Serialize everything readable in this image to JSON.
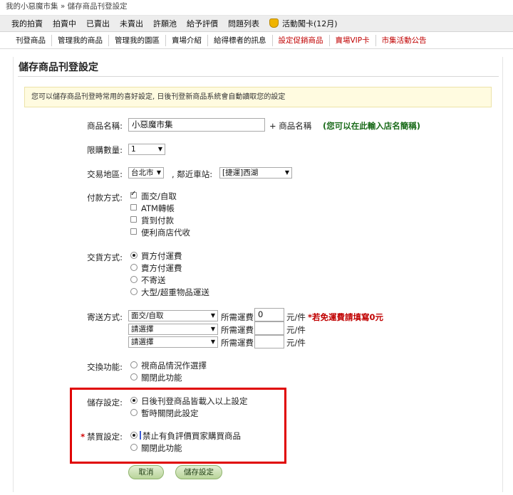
{
  "breadcrumb": {
    "home": "我的小惡魔市集",
    "separator": "»",
    "current": "儲存商品刊登設定"
  },
  "nav_primary": [
    {
      "label": "我的拍賣"
    },
    {
      "label": "拍賣中"
    },
    {
      "label": "已賣出"
    },
    {
      "label": "未賣出"
    },
    {
      "label": "許願池"
    },
    {
      "label": "給予評價"
    },
    {
      "label": "問題列表"
    },
    {
      "label": "活動闖卡(12月)"
    }
  ],
  "nav_secondary": [
    {
      "label": "刊登商品",
      "color": "#111111"
    },
    {
      "label": "管理我的商品",
      "color": "#111111"
    },
    {
      "label": "管理我的園區",
      "color": "#111111"
    },
    {
      "label": "賣場介紹",
      "color": "#111111"
    },
    {
      "label": "給得標者的訊息",
      "color": "#111111"
    },
    {
      "label": "設定促銷商品",
      "color": "#c00000"
    },
    {
      "label": "賣場VIP卡",
      "color": "#c00000"
    },
    {
      "label": "市集活動公告",
      "color": "#c00000"
    }
  ],
  "page_title": "儲存商品刊登設定",
  "notice": "您可以儲存商品刊登時常用的喜好設定, 日後刊登新商品系統會自動讀取您的設定",
  "form": {
    "product_name": {
      "label": "商品名稱:",
      "value": "小惡魔市集",
      "suffix": "+ 商品名稱",
      "note": "(您可以在此輸入店名簡稱)"
    },
    "purchase_limit": {
      "label": "限購數量:",
      "value": "1"
    },
    "trade_area": {
      "label": "交易地區:",
      "city": "台北市",
      "station_label": ", 鄰近車站:",
      "station": "[捷運]西湖"
    },
    "payment": {
      "label": "付款方式:",
      "options": [
        {
          "text": "面交/自取",
          "checked": true
        },
        {
          "text": "ATM轉帳",
          "checked": false
        },
        {
          "text": "貨到付款",
          "checked": false
        },
        {
          "text": "便利商店代收",
          "checked": false
        }
      ]
    },
    "delivery": {
      "label": "交貨方式:",
      "options": [
        {
          "text": "買方付運費",
          "checked": true
        },
        {
          "text": "賣方付運費",
          "checked": false
        },
        {
          "text": "不寄送",
          "checked": false
        },
        {
          "text": "大型/超重物品運送",
          "checked": false
        }
      ]
    },
    "shipping": {
      "label": "寄送方式:",
      "fee_label": "所需運費",
      "unit": "元/件",
      "note": "*若免運費請填寫0元",
      "rows": [
        {
          "method": "面交/自取",
          "fee": "0"
        },
        {
          "method": "請選擇",
          "fee": ""
        },
        {
          "method": "請選擇",
          "fee": ""
        }
      ]
    },
    "exchange": {
      "label": "交換功能:",
      "options": [
        {
          "text": "視商品情況作選擇",
          "checked": false
        },
        {
          "text": "關閉此功能",
          "checked": false
        }
      ]
    },
    "save_setting": {
      "label": "儲存設定:",
      "options": [
        {
          "text": "日後刊登商品皆載入以上設定",
          "checked": true
        },
        {
          "text": "暫時關閉此設定",
          "checked": false
        }
      ]
    },
    "blacklist": {
      "star": "*",
      "label": "禁買設定:",
      "options": [
        {
          "text": "禁止有負評價買家購買商品",
          "checked": true
        },
        {
          "text": "關閉此功能",
          "checked": false
        }
      ]
    }
  },
  "buttons": {
    "cancel": "取消",
    "save": "儲存設定"
  },
  "colors": {
    "accent_red": "#c00000",
    "highlight_border": "#e00000",
    "notice_bg": "#fffbe0",
    "button_green": "#b9d49a"
  }
}
